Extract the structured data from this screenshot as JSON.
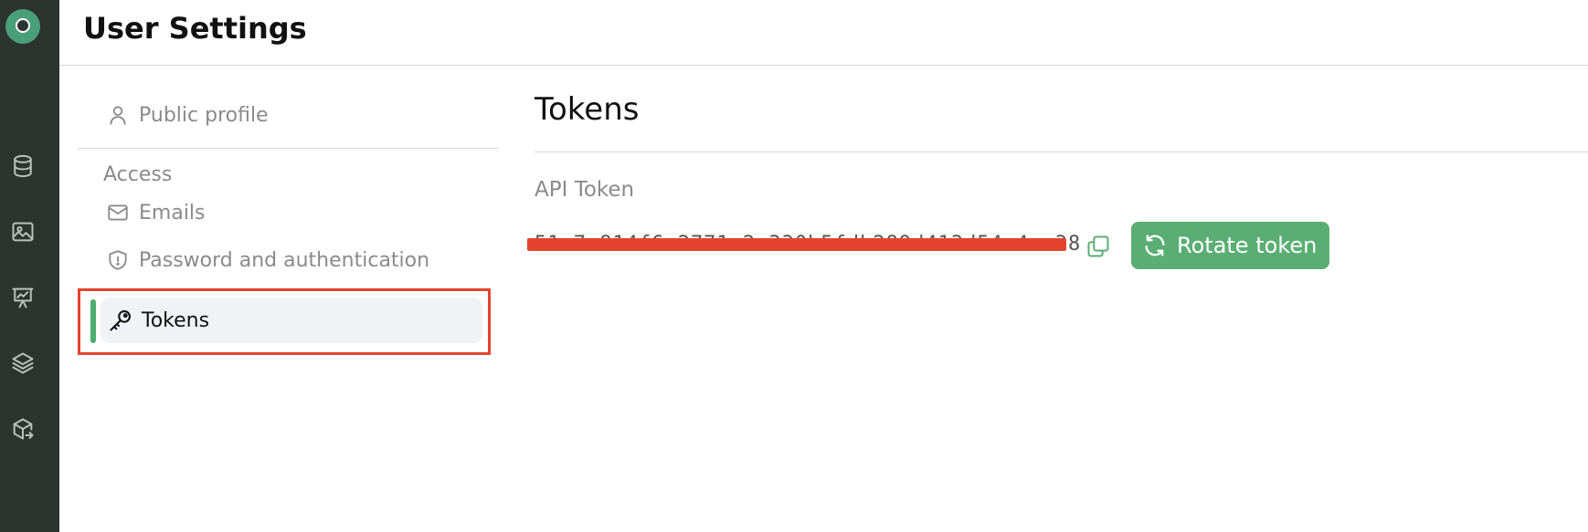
{
  "header": {
    "title": "User Settings"
  },
  "rail": {
    "icons": [
      "app-logo-icon",
      "database-icon",
      "image-icon",
      "presentation-chart-icon",
      "layers-icon",
      "package-export-icon"
    ]
  },
  "nav": {
    "public_profile": "Public profile",
    "section_access": "Access",
    "emails": "Emails",
    "password": "Password and authentication",
    "tokens": "Tokens"
  },
  "main": {
    "title": "Tokens",
    "api_token_label": "API Token",
    "token_value": "51c7a814f6c2771e2a330b5fdb289d413d54a4aa38",
    "rotate_label": "Rotate token"
  },
  "colors": {
    "accent": "#5aae74",
    "highlight_border": "#e5432d",
    "rail_bg": "#2c3430"
  }
}
